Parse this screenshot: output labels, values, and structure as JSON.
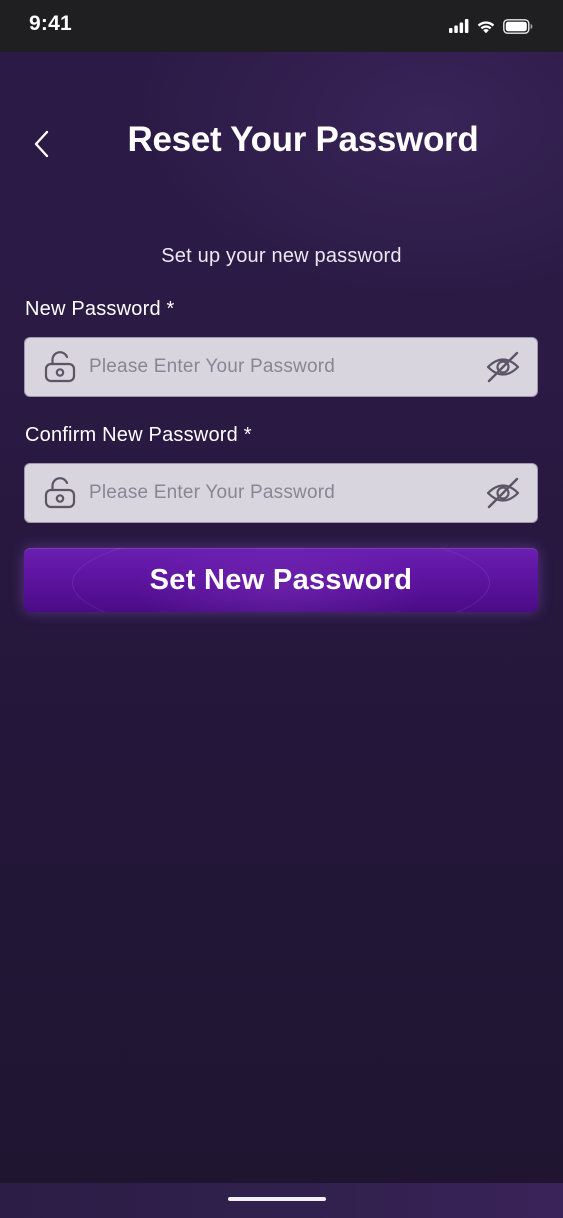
{
  "status_bar": {
    "time": "9:41",
    "icons": [
      "cellular-signal-icon",
      "wifi-icon",
      "battery-icon"
    ]
  },
  "header": {
    "back_icon": "chevron-left-icon",
    "title": "Reset Your Password"
  },
  "subtitle": "Set up your new password",
  "form": {
    "new_password": {
      "label": "New Password *",
      "placeholder": "Please Enter Your Password",
      "value": "",
      "leading_icon": "unlock-icon",
      "trailing_icon": "eye-off-icon"
    },
    "confirm_password": {
      "label": "Confirm New Password *",
      "placeholder": "Please Enter Your Password",
      "value": "",
      "leading_icon": "unlock-icon",
      "trailing_icon": "eye-off-icon"
    },
    "submit_label": "Set New Password"
  },
  "colors": {
    "background_top": "#2c1a47",
    "background_bottom": "#1f1530",
    "input_fill": "#d8d5de",
    "button_primary": "#5a129c",
    "status_bar": "#1f1f21"
  }
}
